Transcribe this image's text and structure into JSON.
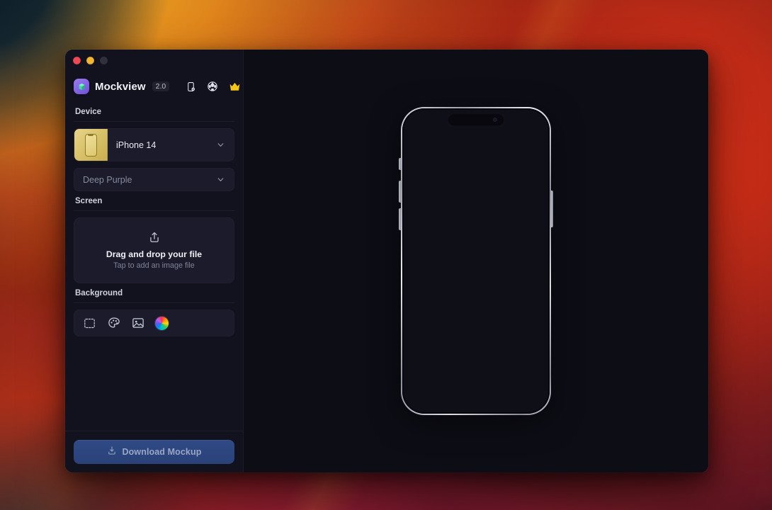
{
  "window": {
    "traffic_lights": [
      {
        "name": "close",
        "color": "#ee4a55"
      },
      {
        "name": "minimize",
        "color": "#f2b632"
      },
      {
        "name": "zoom",
        "color": "#30303d"
      }
    ]
  },
  "brand": {
    "logo_icon": "mockview-logo-icon",
    "name": "Mockview",
    "version": "2.0",
    "actions": [
      {
        "icon": "device-add-icon",
        "name": "add-device-button"
      },
      {
        "icon": "3d-rotate-icon",
        "name": "three-d-view-button"
      },
      {
        "icon": "crown-icon",
        "name": "upgrade-pro-button",
        "color": "#f5c518"
      }
    ]
  },
  "sidebar": {
    "sections": [
      {
        "label": "Device"
      },
      {
        "label": "Screen"
      },
      {
        "label": "Background"
      }
    ],
    "device": {
      "thumbnail_icon": "iphone-thumbnail-icon",
      "model": "iPhone 14",
      "chevron_icon": "chevron-down-icon",
      "color_variant": "Deep Purple",
      "color_chevron_icon": "chevron-down-icon"
    },
    "screen": {
      "upload_icon": "upload-share-icon",
      "title": "Drag and drop your file",
      "subtitle": "Tap to add an image file"
    },
    "background": {
      "options": [
        {
          "icon": "transparent-grid-icon",
          "name": "background-transparent"
        },
        {
          "icon": "palette-icon",
          "name": "background-palette"
        },
        {
          "icon": "image-icon",
          "name": "background-image"
        },
        {
          "icon": "color-wheel-icon",
          "name": "background-color-wheel"
        }
      ]
    },
    "footer": {
      "download_icon": "download-icon",
      "download_label": "Download Mockup"
    }
  },
  "canvas": {
    "background_color": "#0d0d16",
    "mockup": {
      "device_name": "iPhone 14",
      "frame_finish": "silver-metal",
      "screen_color": "#0f0f18",
      "has_notch": true,
      "buttons": [
        "mute-switch",
        "volume-up",
        "volume-down",
        "power-button"
      ]
    }
  }
}
